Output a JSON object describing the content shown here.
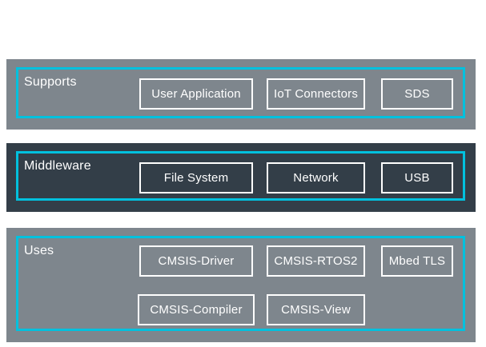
{
  "colors": {
    "band_gray": "#7e868d",
    "band_dark": "#333e48",
    "accent_cyan": "#00c1de",
    "box_border": "#ffffff",
    "text": "#ffffff",
    "page_bg": "#ffffff"
  },
  "bands": [
    {
      "label": "Supports",
      "boxes": [
        {
          "label": "User Application"
        },
        {
          "label": "IoT Connectors"
        },
        {
          "label": "SDS"
        }
      ]
    },
    {
      "label": "Middleware",
      "boxes": [
        {
          "label": "File System"
        },
        {
          "label": "Network"
        },
        {
          "label": "USB"
        }
      ]
    },
    {
      "label": "Uses",
      "boxes": [
        {
          "label": "CMSIS-Driver"
        },
        {
          "label": "CMSIS-RTOS2"
        },
        {
          "label": "Mbed TLS"
        },
        {
          "label": "CMSIS-Compiler"
        },
        {
          "label": "CMSIS-View"
        }
      ]
    }
  ]
}
